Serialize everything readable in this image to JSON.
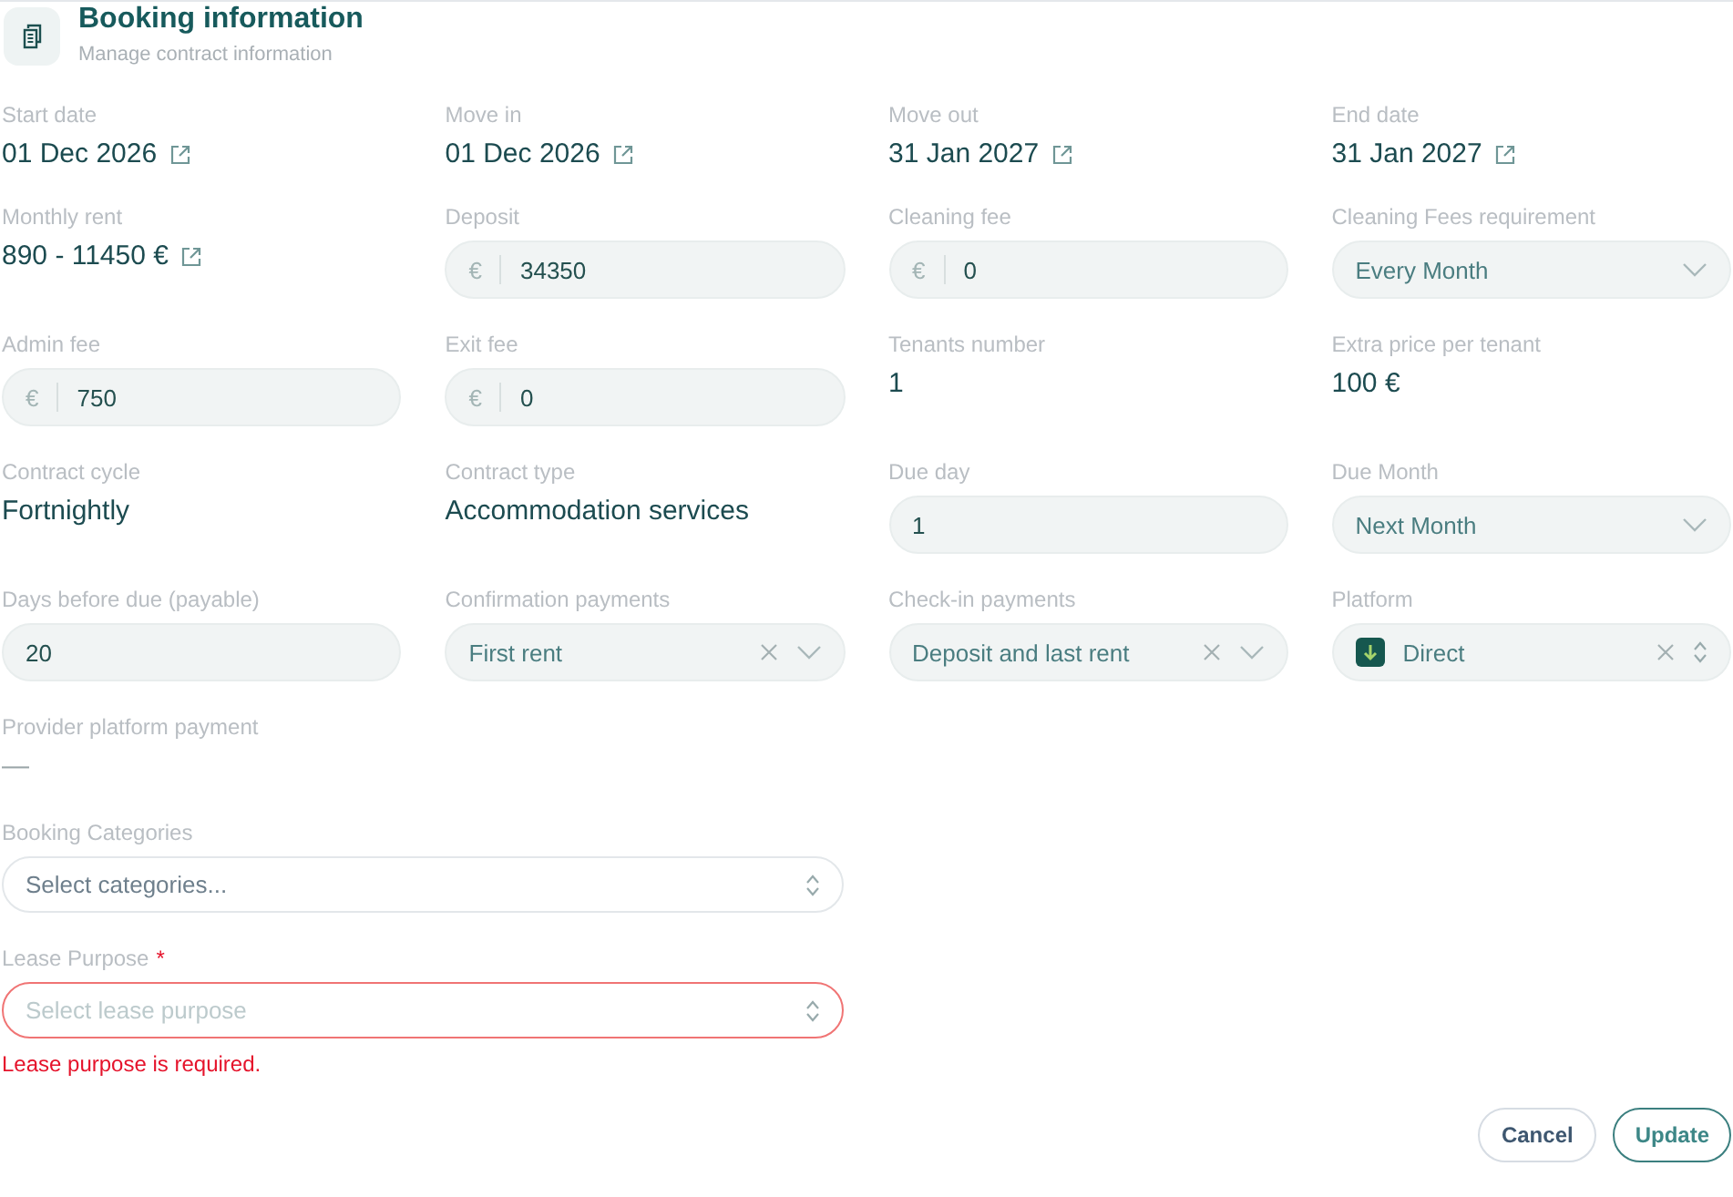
{
  "header": {
    "title": "Booking information",
    "subtitle": "Manage contract information"
  },
  "fields": [
    {
      "label": "Start date",
      "kind": "link",
      "value": "01 Dec 2026"
    },
    {
      "label": "Move in",
      "kind": "link",
      "value": "01 Dec 2026"
    },
    {
      "label": "Move out",
      "kind": "link",
      "value": "31 Jan 2027"
    },
    {
      "label": "End date",
      "kind": "link",
      "value": "31 Jan 2027"
    },
    {
      "label": "Monthly rent",
      "kind": "link",
      "value": "890 - 11450 €"
    },
    {
      "label": "Deposit",
      "kind": "money",
      "currency": "€",
      "value": "34350"
    },
    {
      "label": "Cleaning fee",
      "kind": "money",
      "currency": "€",
      "value": "0"
    },
    {
      "label": "Cleaning Fees requirement",
      "kind": "select",
      "value": "Every Month",
      "clearable": false,
      "has_logo": false
    },
    {
      "label": "Admin fee",
      "kind": "money",
      "currency": "€",
      "value": "750"
    },
    {
      "label": "Exit fee",
      "kind": "money",
      "currency": "€",
      "value": "0"
    },
    {
      "label": "Tenants number",
      "kind": "text",
      "value": "1"
    },
    {
      "label": "Extra price per tenant",
      "kind": "text",
      "value": "100 €"
    },
    {
      "label": "Contract cycle",
      "kind": "text",
      "value": "Fortnightly"
    },
    {
      "label": "Contract type",
      "kind": "text",
      "value": "Accommodation services"
    },
    {
      "label": "Due day",
      "kind": "input",
      "value": "1"
    },
    {
      "label": "Due Month",
      "kind": "select",
      "value": "Next Month",
      "clearable": false,
      "has_logo": false
    },
    {
      "label": "Days before due (payable)",
      "kind": "input",
      "value": "20"
    },
    {
      "label": "Confirmation payments",
      "kind": "select",
      "value": "First rent",
      "clearable": true,
      "has_logo": false
    },
    {
      "label": "Check-in payments",
      "kind": "select",
      "value": "Deposit and last rent",
      "clearable": true,
      "has_logo": false
    },
    {
      "label": "Platform",
      "kind": "combo",
      "value": "Direct",
      "clearable": true,
      "has_logo": true
    },
    {
      "label": "Provider platform payment",
      "kind": "muted",
      "value": "—"
    }
  ],
  "wide_fields": [
    {
      "label": "Booking Categories",
      "placeholder": "Select categories...",
      "invalid": false
    },
    {
      "label": "Lease Purpose",
      "required_mark": "*",
      "placeholder": "Select lease purpose",
      "invalid": true,
      "error": "Lease purpose is required."
    }
  ],
  "buttons": [
    {
      "label": "Cancel",
      "kind": "secondary"
    },
    {
      "label": "Update",
      "kind": "primary"
    }
  ]
}
